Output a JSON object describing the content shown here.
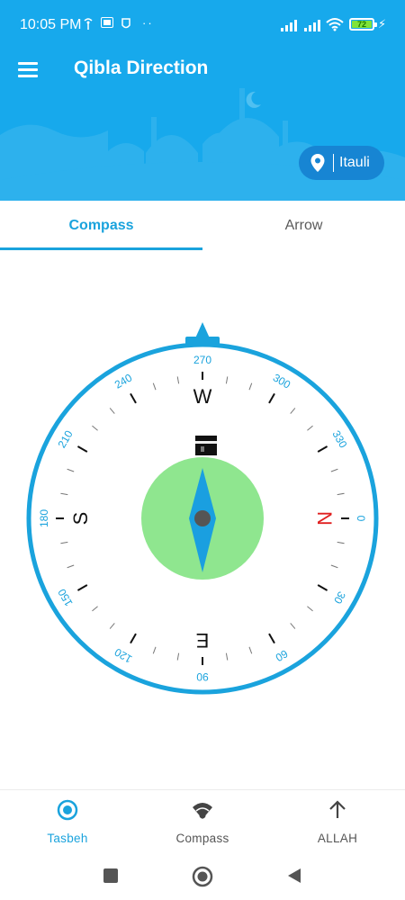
{
  "status_bar": {
    "time": "10:05 PM",
    "battery": "72",
    "icons": [
      "wifi-tether-icon",
      "sim-card-icon",
      "mask-icon",
      "more-dots-icon",
      "cell-signal-icon",
      "cell-signal-icon",
      "wifi-icon",
      "battery-icon",
      "charging-icon"
    ]
  },
  "app_bar": {
    "title": "Qibla Direction",
    "menu_icon": "hamburger-menu-icon"
  },
  "location": {
    "name": "Itauli",
    "icon": "location-pin-icon"
  },
  "tabs": [
    {
      "label": "Compass",
      "active": true
    },
    {
      "label": "Arrow",
      "active": false
    }
  ],
  "compass": {
    "cardinals": [
      "N",
      "E",
      "S",
      "W"
    ],
    "degree_labels": [
      "0",
      "30",
      "60",
      "90",
      "120",
      "150",
      "180",
      "210",
      "240",
      "270",
      "300",
      "330"
    ],
    "kaaba_icon": "kaaba-icon",
    "needle_icon": "compass-needle-icon",
    "qibla_marker_icon": "qibla-pointer-icon"
  },
  "bottom_nav": [
    {
      "label": "Tasbeh",
      "icon": "radio-button-icon",
      "active": true
    },
    {
      "label": "Compass",
      "icon": "wifi-signal-icon",
      "active": false
    },
    {
      "label": "ALLAH",
      "icon": "arrow-up-icon",
      "active": false
    }
  ],
  "colors": {
    "primary": "#17a9ec",
    "accent": "#1aa3dd",
    "north": "#e02020",
    "dial_center": "#8fe68f",
    "needle": "#1a9fe0"
  }
}
